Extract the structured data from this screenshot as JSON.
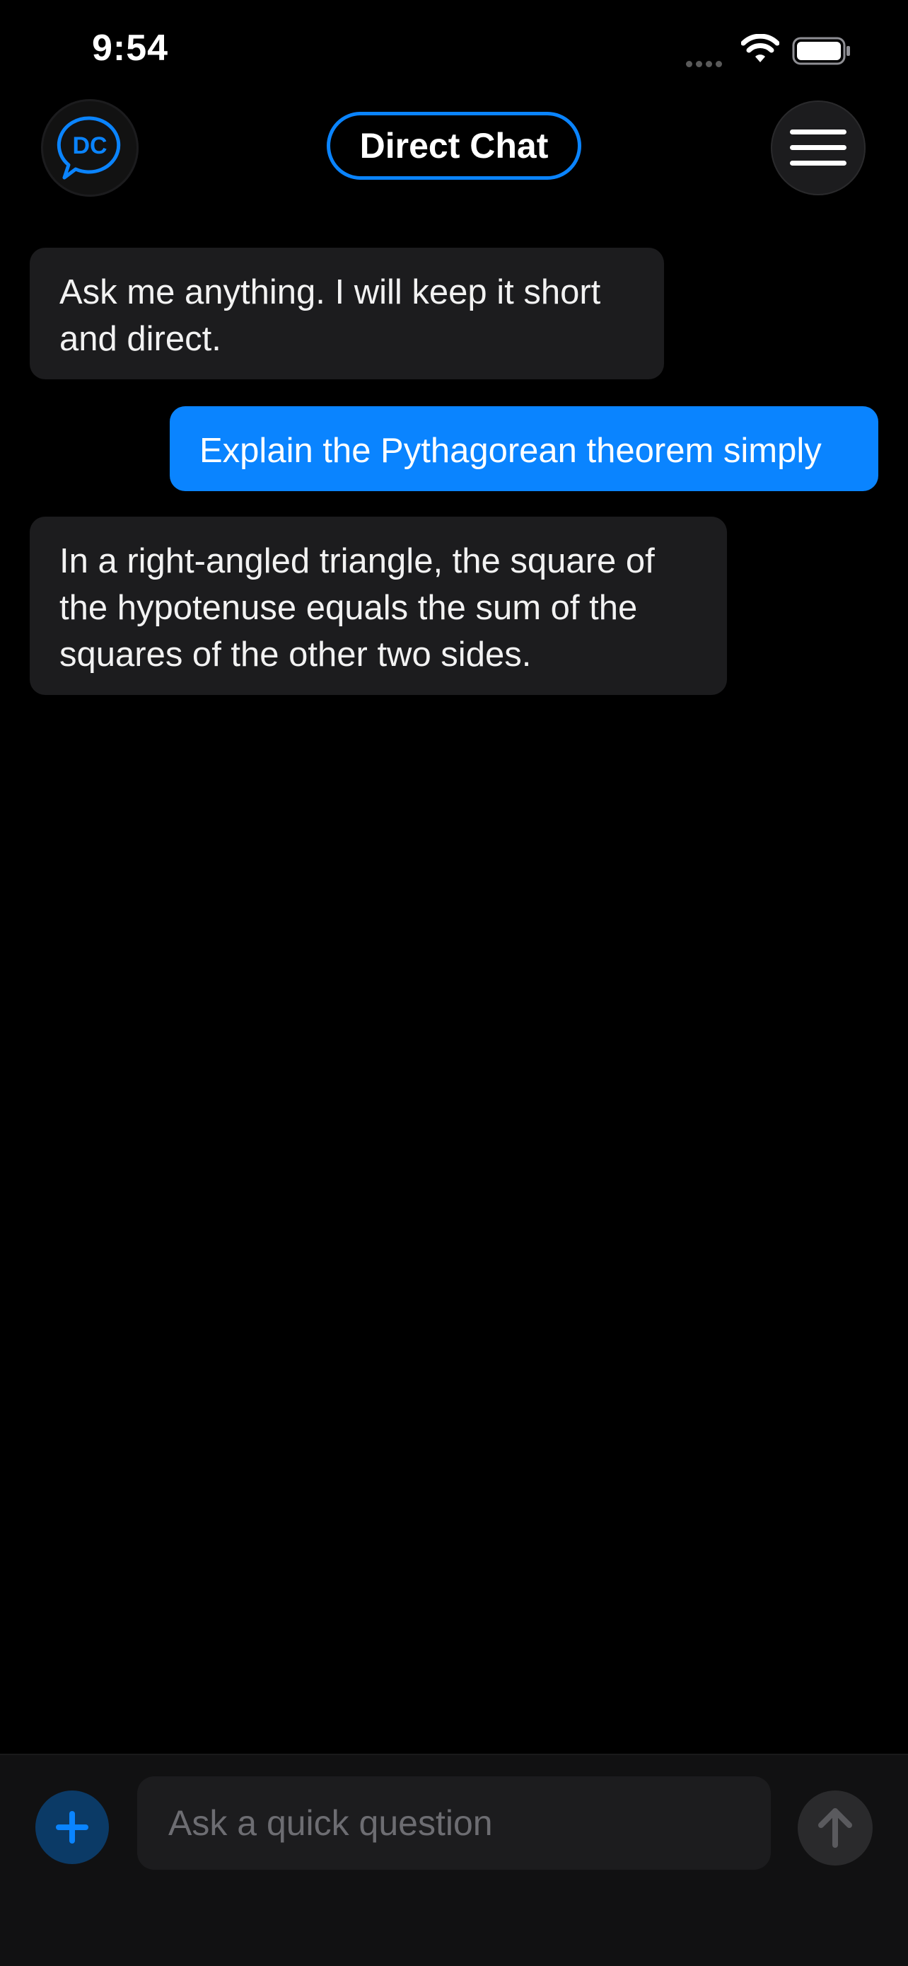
{
  "status_bar": {
    "time": "9:54",
    "icons": [
      "signal-icon",
      "wifi-icon",
      "battery-icon"
    ]
  },
  "header": {
    "logo_text": "DC",
    "title": "Direct Chat",
    "menu_icon": "hamburger-menu-icon"
  },
  "messages": [
    {
      "role": "assistant",
      "text": "Ask me anything. I will keep it short and direct."
    },
    {
      "role": "user",
      "text": "Explain the Pythagorean theorem simply"
    },
    {
      "role": "assistant",
      "text": "In a right-angled triangle, the square of the hypotenuse equals the sum of the squares of the other two sides."
    }
  ],
  "composer": {
    "placeholder": "Ask a quick question",
    "value": "",
    "add_icon": "plus-icon",
    "send_icon": "arrow-up-icon"
  },
  "colors": {
    "accent": "#0a84ff",
    "background": "#000000",
    "bubble_bot": "#1c1c1e",
    "bubble_user": "#0a84ff",
    "composer_bg": "#111112"
  }
}
